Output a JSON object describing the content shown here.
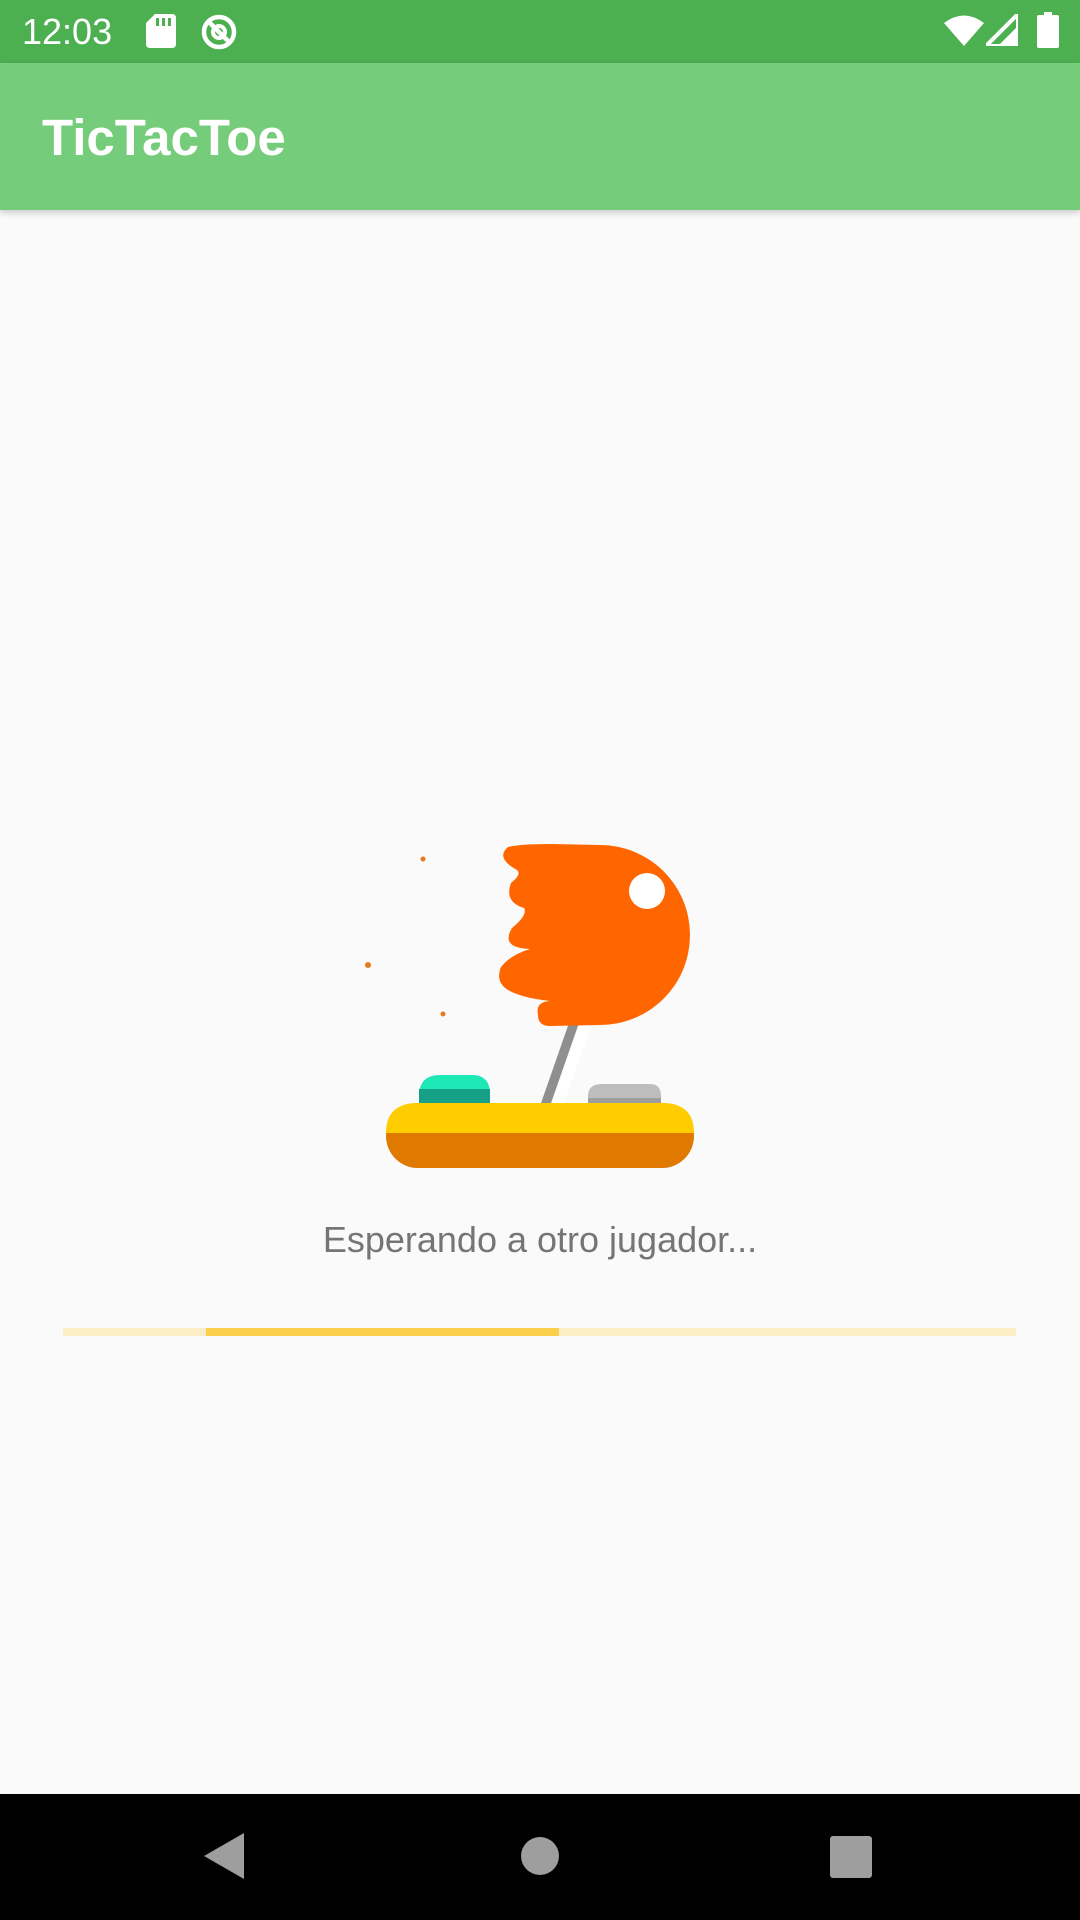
{
  "status_bar": {
    "time": "12:03",
    "left_icons": [
      "sd-card-icon",
      "sync-disabled-icon"
    ],
    "right_icons": [
      "wifi-icon",
      "signal-icon",
      "battery-icon"
    ]
  },
  "app_bar": {
    "title": "TicTacToe"
  },
  "main": {
    "waiting_text": "Esperando a otro jugador...",
    "progress": {
      "segment_start": 0.15,
      "segment_end": 0.52
    }
  },
  "colors": {
    "status_bar": "#4caf50",
    "app_bar": "#75cc7b",
    "joystick_knob": "#ff6600",
    "joystick_base_top": "#ffcc00",
    "joystick_base_bottom": "#e07900",
    "button_teal": "#1de9b6",
    "progress_track": "#fbedc5",
    "progress_fill": "#fbcf4b"
  },
  "nav_bar": {
    "buttons": [
      "back-icon",
      "home-icon",
      "recents-icon"
    ]
  }
}
